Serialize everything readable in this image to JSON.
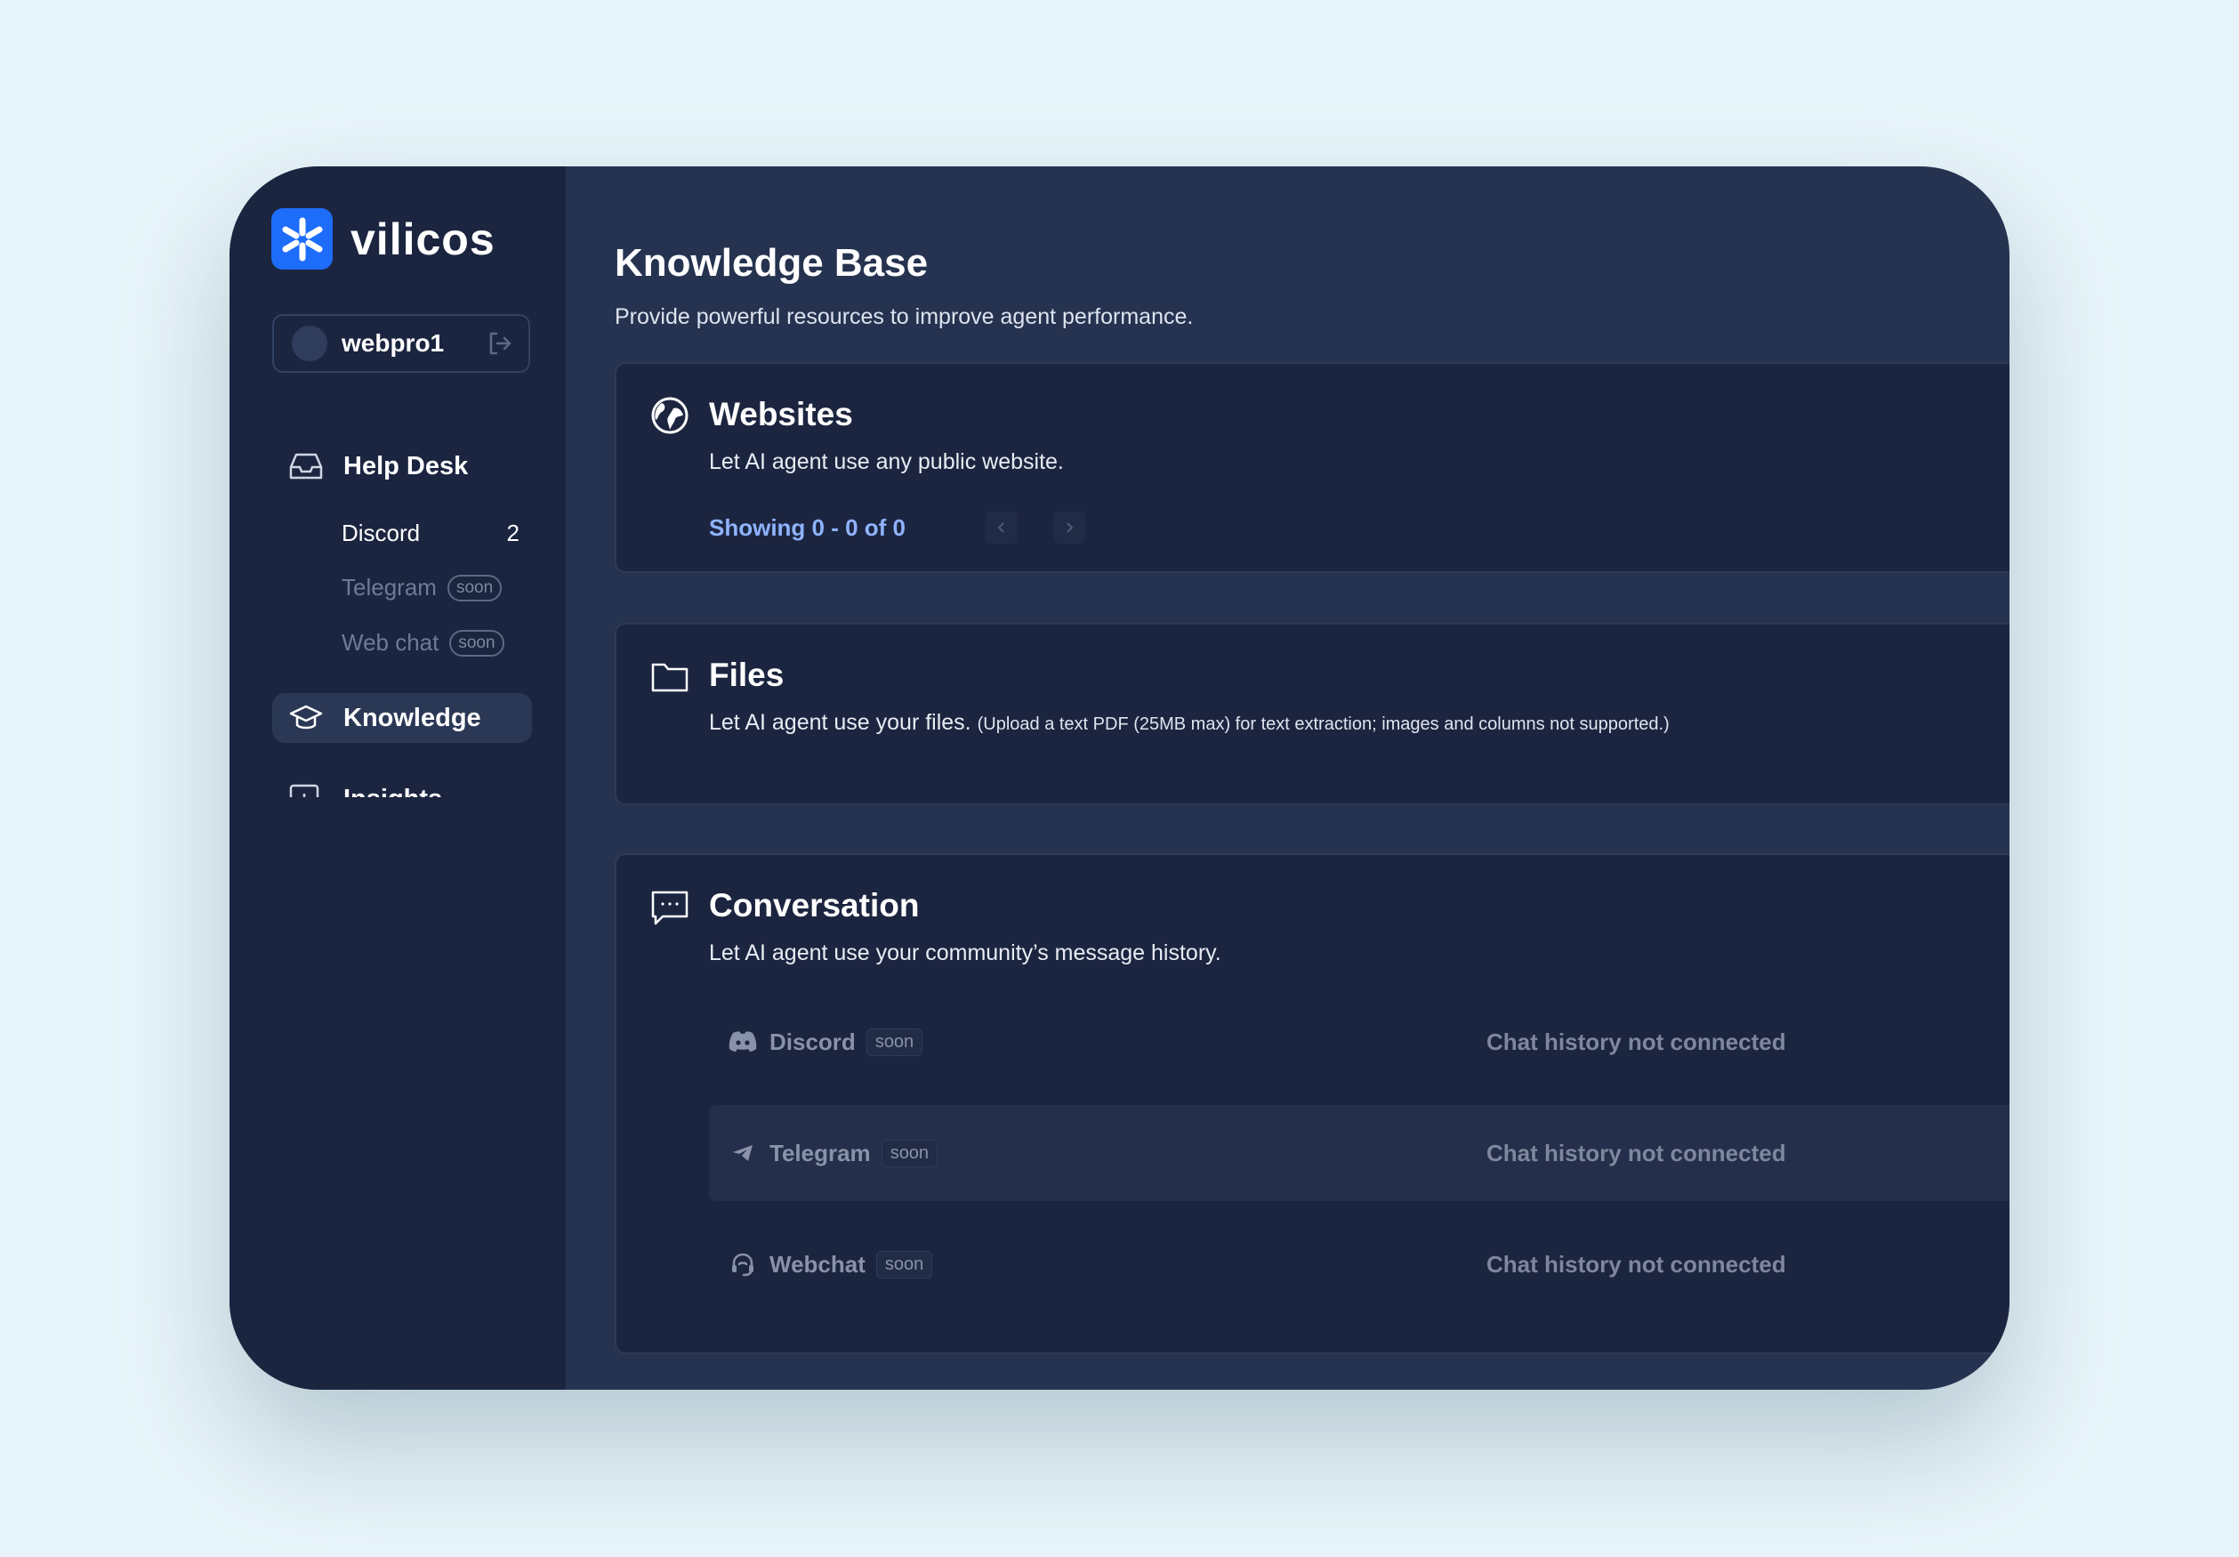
{
  "app": {
    "name": "vilicos"
  },
  "user": {
    "name": "webpro1"
  },
  "nav": {
    "help_desk": "Help Desk",
    "sub_items": [
      {
        "label": "Discord",
        "count": "2"
      },
      {
        "label": "Telegram",
        "badge": "soon"
      },
      {
        "label": "Web chat",
        "badge": "soon"
      }
    ],
    "knowledge": "Knowledge",
    "insights": "Insights"
  },
  "page": {
    "title": "Knowledge Base",
    "subtitle": "Provide powerful resources to improve agent performance."
  },
  "websites": {
    "title": "Websites",
    "description": "Let AI agent use any public website.",
    "pager_text": "Showing 0 - 0 of 0"
  },
  "files": {
    "title": "Files",
    "description": "Let AI agent use your files.",
    "note": "(Upload a text PDF (25MB max) for text extraction; images and columns not supported.)"
  },
  "conversation": {
    "title": "Conversation",
    "description": "Let AI agent use your community’s message history.",
    "rows": [
      {
        "name": "Discord",
        "badge": "soon",
        "status": "Chat history not connected"
      },
      {
        "name": "Telegram",
        "badge": "soon",
        "status": "Chat history not connected"
      },
      {
        "name": "Webchat",
        "badge": "soon",
        "status": "Chat history not connected"
      }
    ]
  },
  "icons": {
    "logo": "vilicos-logo-icon",
    "logout": "logout-icon",
    "help_desk": "inbox-icon",
    "knowledge": "graduation-cap-icon",
    "insights": "bar-chart-icon",
    "websites": "globe-icon",
    "files": "folder-icon",
    "conversation": "chat-bubble-icon",
    "discord": "discord-icon",
    "telegram": "telegram-icon",
    "webchat": "headset-icon"
  },
  "colors": {
    "background": "#e7f4f9",
    "sidebar": "#1b2540",
    "main": "#263350",
    "card": "#1c2540",
    "accent": "#1d6dfa",
    "link": "#8fb3ff"
  }
}
